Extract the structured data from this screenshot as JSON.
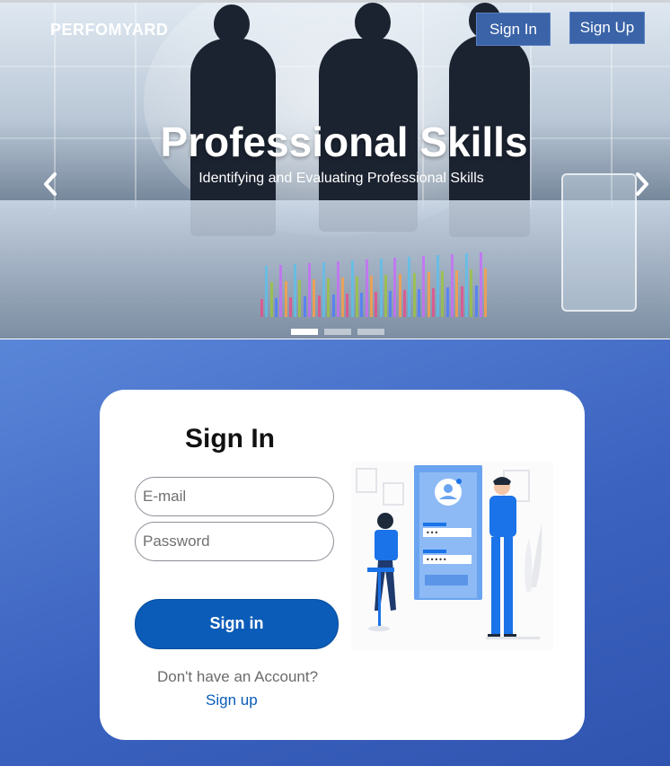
{
  "header": {
    "brand": "PERFOMYARD",
    "nav": {
      "sign_in_label": "Sign In",
      "sign_up_label": "Sign Up"
    }
  },
  "hero": {
    "title": "Professional Skills",
    "subtitle": "Identifying and Evaluating Professional Skills",
    "prev_icon": "chevron-left-icon",
    "next_icon": "chevron-right-icon",
    "slides_count": 3,
    "active_slide": 1
  },
  "signin_card": {
    "title": "Sign In",
    "email_placeholder": "E-mail",
    "password_placeholder": "Password",
    "submit_label": "Sign in",
    "no_account_text": "Don't have an Account?",
    "signup_link": "Sign up",
    "illustration": "login-illustration"
  },
  "colors": {
    "accent": "#0b5cb8",
    "bottom_gradient_start": "#5a86d8",
    "bottom_gradient_end": "#2f54b0",
    "nav_button": "#3a63a8"
  }
}
